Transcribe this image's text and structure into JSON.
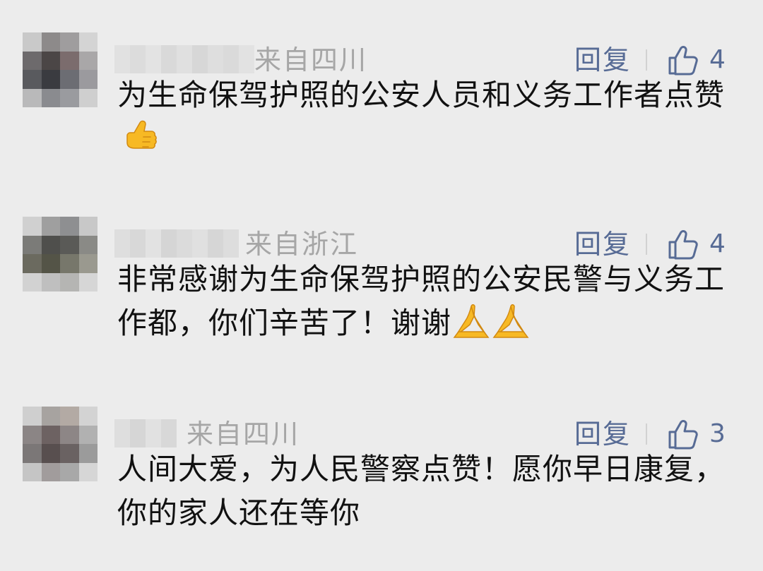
{
  "comments": [
    {
      "location": "来自四川",
      "reply_label": "回复",
      "like_count": "4",
      "text": "为生命保驾护照的公安人员和义务工作者点赞",
      "trailing_emoji": [
        "thumbs-up"
      ]
    },
    {
      "location": "来自浙江",
      "reply_label": "回复",
      "like_count": "4",
      "text": "非常感谢为生命保驾护照的公安民警与义务工作都，你们辛苦了！谢谢",
      "trailing_emoji": [
        "folded-hands",
        "folded-hands"
      ]
    },
    {
      "location": "来自四川",
      "reply_label": "回复",
      "like_count": "3",
      "text": "人间大爱，为人民警察点赞！愿你早日康复，你的家人还在等你",
      "trailing_emoji": []
    }
  ],
  "colors": {
    "background": "#ececec",
    "link": "#576b95",
    "muted": "#a6a6a6",
    "text": "#111111"
  },
  "icons": {
    "like": "thumbs-up-outline-icon"
  }
}
